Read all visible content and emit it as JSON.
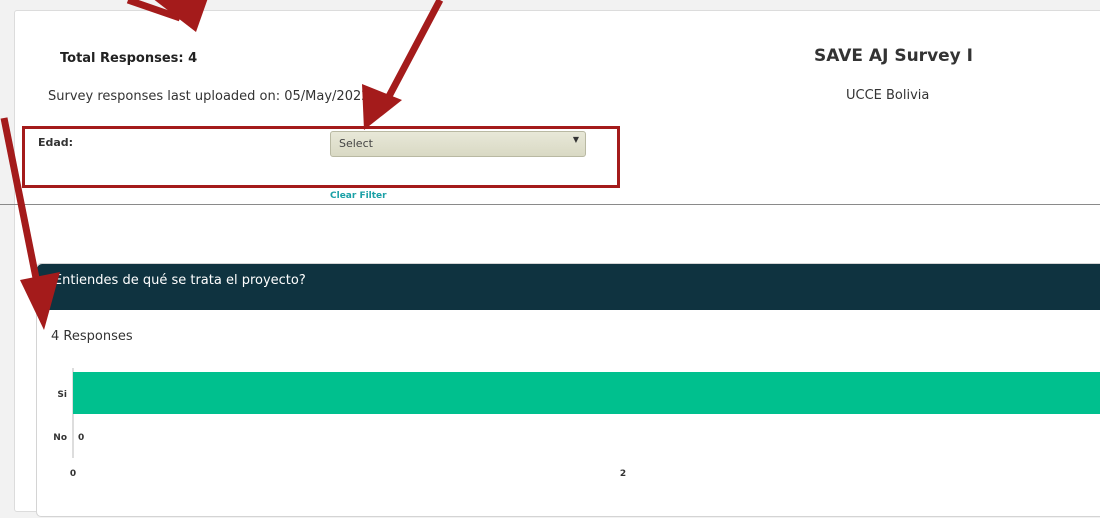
{
  "header": {
    "total_responses": "Total Responses: 4",
    "uploaded": "Survey responses last uploaded on: 05/May/2022",
    "survey_title": "SAVE AJ Survey I",
    "survey_subtitle": "UCCE Bolivia"
  },
  "filter": {
    "label": "Edad:",
    "select_value": "Select",
    "clear_label": "Clear Filter"
  },
  "question": {
    "title": "¿Entiendes de qué se trata el proyecto?",
    "responses": "4 Responses"
  },
  "chart_data": {
    "type": "bar",
    "orientation": "horizontal",
    "categories": [
      "Si",
      "No"
    ],
    "values": [
      4,
      0
    ],
    "data_labels": [
      "",
      "0"
    ],
    "x_ticks": [
      "0",
      "2"
    ],
    "xlim": [
      0,
      4
    ],
    "bar_color": "#00c08e",
    "grid": false
  },
  "colors": {
    "header_bg": "#0f3340",
    "accent": "#1aa0a6",
    "annotation": "#a41b1b"
  }
}
